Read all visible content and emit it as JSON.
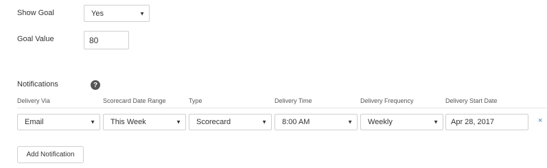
{
  "show_goal": {
    "label": "Show Goal",
    "selected": "Yes"
  },
  "goal_value": {
    "label": "Goal Value",
    "value": "80"
  },
  "notifications": {
    "label": "Notifications",
    "help_glyph": "?",
    "columns": [
      "Delivery Via",
      "Scorecard Date Range",
      "Type",
      "Delivery Time",
      "Delivery Frequency",
      "Delivery Start Date"
    ],
    "rows": [
      {
        "delivery_via": "Email",
        "date_range": "This Week",
        "type": "Scorecard",
        "delivery_time": "8:00 AM",
        "frequency": "Weekly",
        "start_date": "Apr 28, 2017",
        "remove_glyph": "×"
      }
    ],
    "add_label": "Add Notification"
  },
  "icons": {
    "caret": "chevron-down-icon",
    "help": "help-icon",
    "remove": "close-icon"
  },
  "colors": {
    "accent": "#2d7fc4",
    "border": "#cfcfcf"
  }
}
